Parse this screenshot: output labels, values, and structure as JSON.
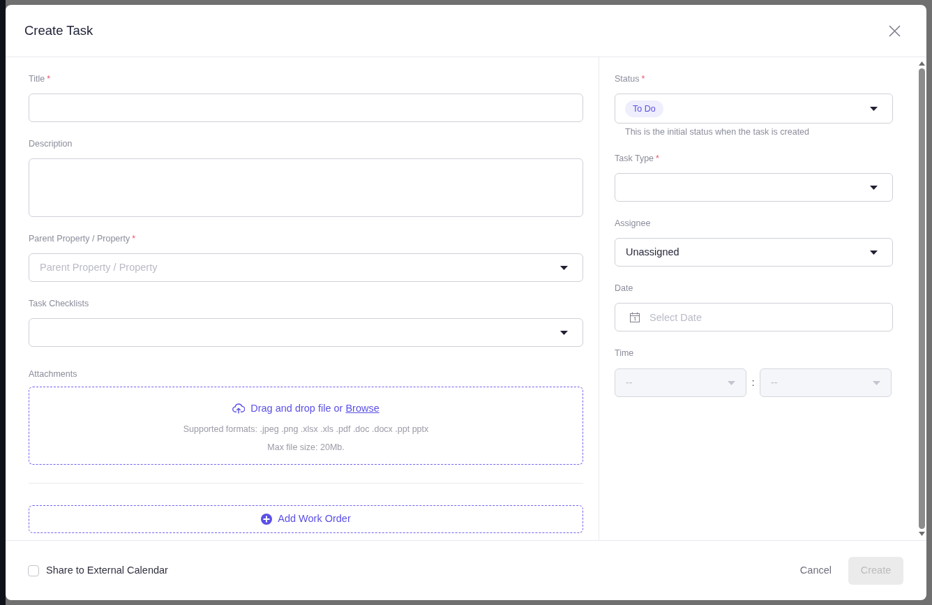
{
  "dialog": {
    "title": "Create Task"
  },
  "left_fields": [
    {
      "kind": "text",
      "label": "Title",
      "required_mark": "*"
    },
    {
      "kind": "textarea",
      "label": "Description"
    },
    {
      "kind": "select",
      "label": "Parent Property / Property",
      "required_mark": "*",
      "placeholder": "Parent Property / Property"
    },
    {
      "kind": "select",
      "label": "Task Checklists"
    }
  ],
  "attachments": {
    "label": "Attachments",
    "prompt": "Drag and drop file or",
    "link": "Browse",
    "formats": "Supported formats: .jpeg .png .xlsx .xls .pdf .doc .docx .ppt pptx",
    "max_size": "Max file size: 20Mb."
  },
  "add_work_order": {
    "label": "Add Work Order"
  },
  "right_fields": [
    {
      "kind": "status",
      "label": "Status",
      "required_mark": "*",
      "value": "To Do",
      "help": "This is the initial status when the task is created"
    },
    {
      "kind": "select",
      "label": "Task Type",
      "required_mark": "*"
    },
    {
      "kind": "select",
      "label": "Assignee",
      "value": "Unassigned"
    },
    {
      "kind": "date",
      "label": "Date",
      "placeholder": "Select Date"
    },
    {
      "kind": "time",
      "label": "Time",
      "disabled": true,
      "hour": "--",
      "separator": ":",
      "minute": "--"
    }
  ],
  "footer": {
    "share_to_calendar": {
      "label": "Share to External Calendar",
      "checked": false
    },
    "cancel": {
      "label": "Cancel"
    },
    "create": {
      "label": "Create",
      "disabled": true
    }
  }
}
